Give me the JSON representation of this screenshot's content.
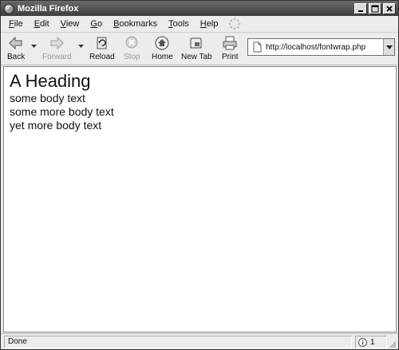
{
  "window": {
    "title": "Mozilla Firefox"
  },
  "menu": {
    "items": [
      {
        "key": "F",
        "rest": "ile"
      },
      {
        "key": "E",
        "rest": "dit"
      },
      {
        "key": "V",
        "rest": "iew"
      },
      {
        "key": "G",
        "rest": "o"
      },
      {
        "key": "B",
        "rest": "ookmarks"
      },
      {
        "key": "T",
        "rest": "ools"
      },
      {
        "key": "H",
        "rest": "elp"
      }
    ]
  },
  "toolbar": {
    "back_label": "Back",
    "forward_label": "Forward",
    "reload_label": "Reload",
    "stop_label": "Stop",
    "home_label": "Home",
    "newtab_label": "New Tab",
    "print_label": "Print",
    "url": "http://localhost/fontwrap.php"
  },
  "page": {
    "heading": "A Heading",
    "paragraphs": [
      "some body text",
      "some more body text",
      "yet more body text"
    ]
  },
  "status": {
    "text": "Done",
    "info_count": "1"
  },
  "icons": {
    "app": "firefox-icon",
    "back": "back-arrow-icon",
    "forward": "forward-arrow-icon",
    "reload": "reload-icon",
    "stop": "stop-icon",
    "home": "home-icon",
    "newtab": "new-tab-icon",
    "print": "printer-icon",
    "info": "info-icon"
  }
}
